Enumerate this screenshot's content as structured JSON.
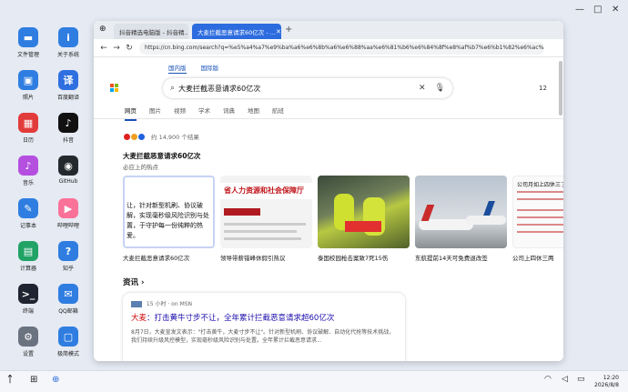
{
  "desktop": {
    "icons_left": [
      {
        "label": "文件管理",
        "icon": "folder-icon",
        "color": "#2f7de1"
      },
      {
        "label": "照片",
        "icon": "photos-icon",
        "color": "#2f7de1"
      },
      {
        "label": "日历",
        "icon": "calendar-icon",
        "color": "#e23b3b"
      },
      {
        "label": "音乐",
        "icon": "music-icon",
        "color": "#b44fe0"
      },
      {
        "label": "记事本",
        "icon": "notepad-icon",
        "color": "#2f7de1"
      },
      {
        "label": "计算器",
        "icon": "calculator-icon",
        "color": "#21a366"
      },
      {
        "label": "终端",
        "icon": "terminal-icon",
        "color": "#1e2430"
      },
      {
        "label": "设置",
        "icon": "settings-icon",
        "color": "#6b7280"
      }
    ],
    "icons_right": [
      {
        "label": "关于系统",
        "icon": "info-icon",
        "color": "#2f7de1"
      },
      {
        "label": "百度翻译",
        "icon": "translate-icon",
        "color": "#2f6fe0"
      },
      {
        "label": "抖音",
        "icon": "tiktok-icon",
        "color": "#111111"
      },
      {
        "label": "GitHub",
        "icon": "github-icon",
        "color": "#24292e"
      },
      {
        "label": "哔哩哔哩",
        "icon": "bilibili-icon",
        "color": "#fb7299"
      },
      {
        "label": "知乎",
        "icon": "zhihu-icon",
        "color": "#2f7de1"
      },
      {
        "label": "QQ邮箱",
        "icon": "mail-icon",
        "color": "#2f7de1"
      },
      {
        "label": "极简模式",
        "icon": "minimal-mode-icon",
        "color": "#2f7de1"
      }
    ],
    "window_controls": {
      "minimize": "—",
      "maximize": "□",
      "close": "✕"
    }
  },
  "browser": {
    "tabs": [
      {
        "title": "抖音精选电脑版 - 抖音精...",
        "active": false
      },
      {
        "title": "大麦拦截恶意请求60亿次 - ...",
        "active": true
      }
    ],
    "new_tab": "+",
    "nav": {
      "back": "←",
      "forward": "→",
      "reload": "↻"
    },
    "url": "https://cn.bing.com/search?q=%e5%a4%a7%e9%ba%a6%e6%8b%a6%e6%88%aa%e6%81%b6%e6%84%8f%e8%af%b7%e6%b1%82%e6%ac%a1&qs=..."
  },
  "bing": {
    "region_tabs": [
      "国内版",
      "国际版"
    ],
    "query": "大麦拦截恶意请求60亿次",
    "rewards": "12",
    "nav_tabs": [
      "网页",
      "图片",
      "视频",
      "学术",
      "词典",
      "地图",
      "航班"
    ],
    "result_count": "约 14,900 个结果",
    "hot_title": "大麦拦截恶意请求60亿次",
    "hot_sub": "必应上的热点",
    "cards": [
      {
        "title": "大麦拦截恶意请求60亿次",
        "snippet": "让，针对新型机刷、协议破解，实现毫秒级风险识别与处置，于守护每一份纯粹的热爱。"
      },
      {
        "title": "领导带薪错峰休假引热议",
        "snippet": "省人力资源和社会保障厅"
      },
      {
        "title": "泰国校园枪击案致7死15伤",
        "snippet": ""
      },
      {
        "title": "东航提前14天可免费退改签",
        "snippet": ""
      },
      {
        "title": "公司上四休三两",
        "snippet": "公司月如上四休三了"
      }
    ],
    "section": "资讯 ›",
    "news": {
      "meta": "15 小时 · on MSN",
      "title_red": "大麦",
      "title_rest": "：打击黄牛寸步不让，全年累计拦截恶意请求超60亿次",
      "snippet": "8月7日，大麦宣发文表示：\"打击黄牛，大麦寸步不让\"。针对新型机刷、协议破解、自动化代抢等技术挑战，我们持续升级风控模型，实现毫秒级风险识别与处置。全年累计拦截恶意请求..."
    }
  },
  "taskbar": {
    "time": "12:20",
    "date": "2026/8/8"
  }
}
